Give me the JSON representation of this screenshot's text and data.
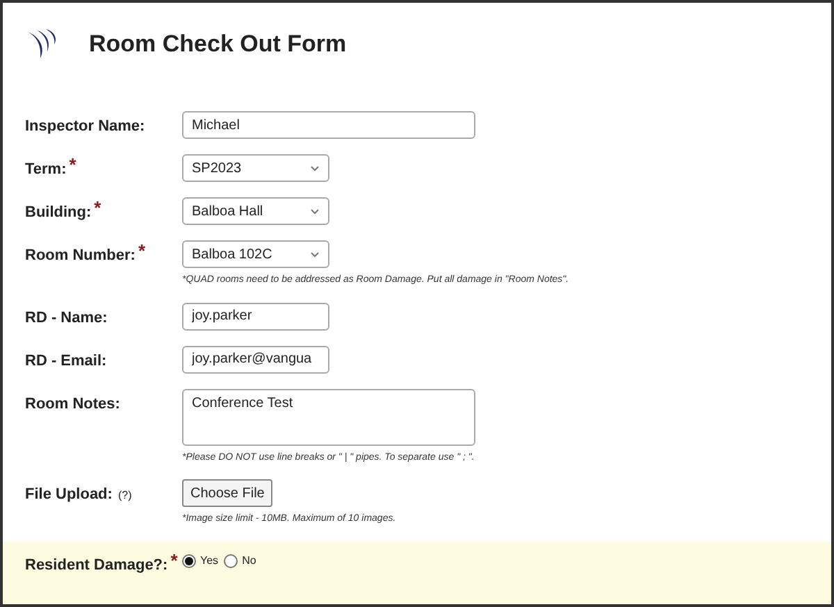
{
  "header": {
    "title": "Room Check Out Form"
  },
  "fields": [
    {
      "kind": "wide_text",
      "label": "Inspector Name:",
      "value": "Michael"
    },
    {
      "kind": "select",
      "label": "Term:",
      "required_mark": "*",
      "value": "SP2023"
    },
    {
      "kind": "select",
      "label": "Building:",
      "required_mark": "*",
      "value": "Balboa Hall"
    },
    {
      "kind": "select",
      "label": "Room Number:",
      "required_mark": "*",
      "value": "Balboa 102C",
      "note": "*QUAD rooms need to be addressed as Room Damage. Put all damage in \"Room Notes\"."
    },
    {
      "kind": "text",
      "label": "RD - Name:",
      "value": "joy.parker"
    },
    {
      "kind": "text",
      "label": "RD - Email:",
      "value": "joy.parker@vangua"
    },
    {
      "kind": "textarea",
      "label": "Room Notes:",
      "value": "Conference Test",
      "note": "*Please DO NOT use line breaks or \" | \" pipes. To separate use \" ; \"."
    },
    {
      "kind": "file",
      "label": "File Upload:",
      "hint": "(?)",
      "button": "Choose File",
      "note": "*Image size limit - 10MB. Maximum of 10 images."
    },
    {
      "kind": "radio",
      "label": "Resident Damage?:",
      "required_mark": "*",
      "highlighted": true,
      "options": [
        {
          "label": "Yes",
          "selected": true
        },
        {
          "label": "No",
          "selected": false
        }
      ]
    }
  ]
}
